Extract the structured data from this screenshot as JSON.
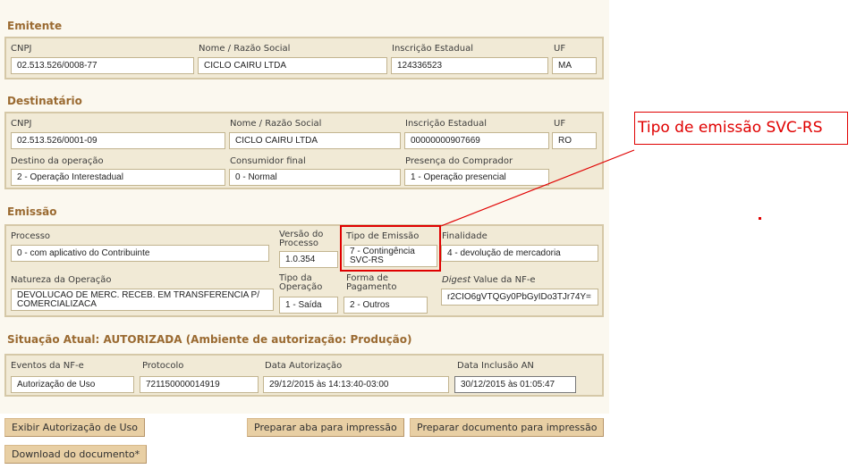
{
  "emitente": {
    "title": "Emitente",
    "cnpj": {
      "label": "CNPJ",
      "value": "02.513.526/0008-77"
    },
    "nome": {
      "label": "Nome / Razão Social",
      "value": "CICLO CAIRU LTDA"
    },
    "ie": {
      "label": "Inscrição Estadual",
      "value": "124336523"
    },
    "uf": {
      "label": "UF",
      "value": "MA"
    }
  },
  "destinatario": {
    "title": "Destinatário",
    "cnpj": {
      "label": "CNPJ",
      "value": "02.513.526/0001-09"
    },
    "nome": {
      "label": "Nome / Razão Social",
      "value": "CICLO CAIRU LTDA"
    },
    "ie": {
      "label": "Inscrição Estadual",
      "value": "00000000907669"
    },
    "uf": {
      "label": "UF",
      "value": "RO"
    },
    "destino": {
      "label": "Destino da operação",
      "value": "2 - Operação Interestadual"
    },
    "consumidor": {
      "label": "Consumidor final",
      "value": "0 - Normal"
    },
    "presenca": {
      "label": "Presença do Comprador",
      "value": "1 - Operação presencial"
    }
  },
  "emissao": {
    "title": "Emissão",
    "processo": {
      "label": "Processo",
      "value": "0 - com aplicativo do Contribuinte"
    },
    "versao": {
      "label": "Versão do Processo",
      "value": "1.0.354"
    },
    "tipo_emissao": {
      "label": "Tipo de Emissão",
      "value": "7 - Contingência SVC-RS"
    },
    "finalidade": {
      "label": "Finalidade",
      "value": "4 - devolução de mercadoria"
    },
    "natureza": {
      "label": "Natureza da Operação",
      "value": "DEVOLUCAO DE MERC. RECEB. EM TRANSFERENCIA P/ COMERCIALIZACA"
    },
    "tipo_operacao": {
      "label": "Tipo da Operação",
      "value": "1 - Saída"
    },
    "forma_pagamento": {
      "label": "Forma de Pagamento",
      "value": "2 - Outros"
    },
    "digest": {
      "label_em": "Digest",
      "label_rest": " Value da NF-e",
      "value": "r2CIO6gVTQGy0PbGyIDo3TJr74Y="
    }
  },
  "situacao": {
    "title": "Situação Atual: AUTORIZADA (Ambiente de autorização: Produção)",
    "eventos": {
      "label": "Eventos da NF-e",
      "value": "Autorização de Uso"
    },
    "protocolo": {
      "label": "Protocolo",
      "value": "721150000014919"
    },
    "data_autorizacao": {
      "label": "Data Autorização",
      "value": "29/12/2015 às 14:13:40-03:00"
    },
    "data_inclusao": {
      "label": "Data Inclusão AN",
      "value": "30/12/2015 às 01:05:47"
    }
  },
  "buttons": {
    "exibir": "Exibir Autorização de Uso",
    "preparar_aba": "Preparar aba para impressão",
    "preparar_doc": "Preparar documento para impressão",
    "download": "Download do documento*"
  },
  "annotation": {
    "callout_text": "Tipo de emissão SVC-RS",
    "color": "#e00000"
  }
}
